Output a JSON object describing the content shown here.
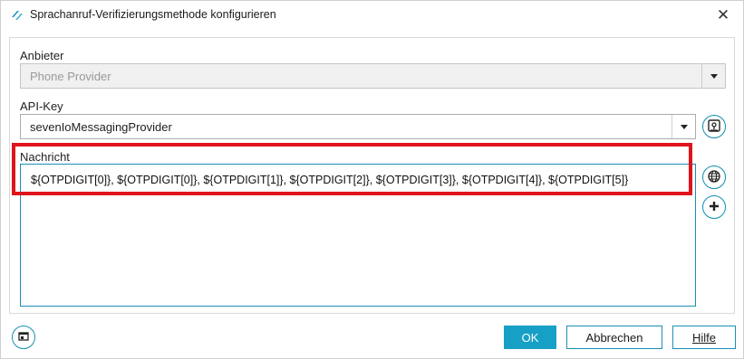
{
  "window": {
    "title": "Sprachanruf-Verifizierungsmethode konfigurieren",
    "close_symbol": "✕"
  },
  "fields": {
    "provider": {
      "label": "Anbieter",
      "value": "Phone Provider"
    },
    "api_key": {
      "label": "API-Key",
      "value": "sevenIoMessagingProvider"
    },
    "message": {
      "label": "Nachricht",
      "value": "${OTPDIGIT[0]}, ${OTPDIGIT[0]}, ${OTPDIGIT[1]}, ${OTPDIGIT[2]}, ${OTPDIGIT[3]}, ${OTPDIGIT[4]}, ${OTPDIGIT[5]}"
    }
  },
  "icons": {
    "app": "app-logo-icon",
    "api_key_action": "key-dialog-icon",
    "globe": "globe-icon",
    "add": "plus-icon",
    "corner": "window-icon"
  },
  "buttons": {
    "ok": "OK",
    "cancel": "Abbrechen",
    "help": "Hilfe"
  },
  "colors": {
    "accent": "#17a0c6",
    "highlight": "#e0141c"
  }
}
